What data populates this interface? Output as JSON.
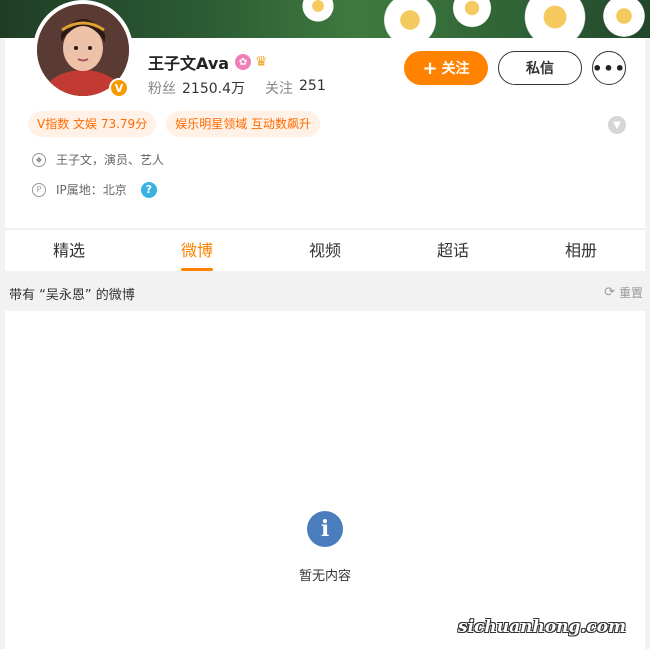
{
  "profile": {
    "name": "王子文Ava",
    "verified_badge": "V",
    "followers_label": "粉丝",
    "followers_value": "2150.4万",
    "following_label": "关注",
    "following_value": "251"
  },
  "actions": {
    "follow_label": "关注",
    "message_label": "私信",
    "more_label": "•••"
  },
  "tags": [
    "V指数 文娱 73.79分",
    "娱乐明星领域 互动数飙升"
  ],
  "info": {
    "description": "王子文，演员、艺人",
    "ip_location": "IP属地：北京",
    "help": "?"
  },
  "tabs": [
    "精选",
    "微博",
    "视频",
    "超话",
    "相册"
  ],
  "active_tab": "微博",
  "filter": {
    "text": "带有 “吴永恩” 的微博",
    "reset_label": "重置"
  },
  "empty_state": {
    "text": "暂无内容"
  },
  "watermark": "sichuanhong.com",
  "colors": {
    "accent": "#ff8200",
    "tag_bg": "#fff1e6",
    "info_blue": "#4a7dbd"
  }
}
